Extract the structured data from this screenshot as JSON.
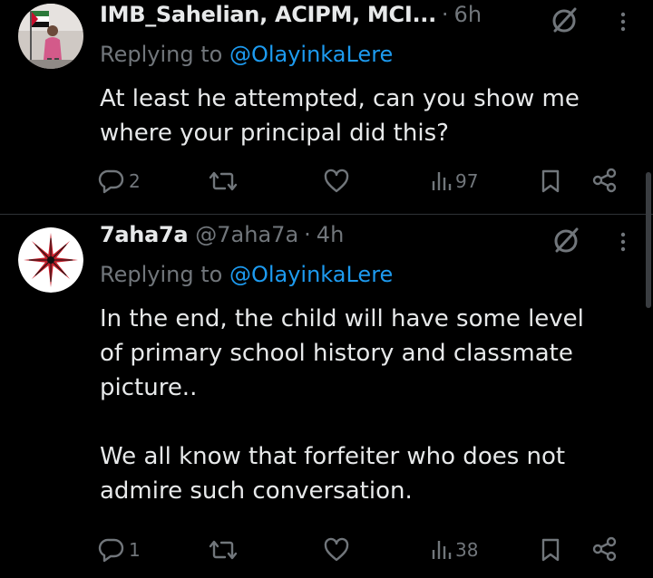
{
  "tweets": [
    {
      "name": "IMB_Sahelian, ACIPM, MCI...",
      "handle": "",
      "time": "6h",
      "replying_prefix": "Replying to",
      "replying_to": "@OlayinkaLere",
      "body": "At least he attempted, can you show me\nwhere your principal did this?",
      "reply_count": "2",
      "retweet_count": "",
      "like_count": "",
      "views": "97",
      "avatar_icon": "user-photo-avatar"
    },
    {
      "name": "7aha7a",
      "handle": "@7aha7a",
      "time": "4h",
      "replying_prefix": "Replying to",
      "replying_to": "@OlayinkaLere",
      "body": "In the end, the child will have some level\nof primary school history and classmate\npicture..\n\nWe all know that forfeiter who does not\nadmire such conversation.",
      "reply_count": "1",
      "retweet_count": "",
      "like_count": "",
      "views": "38",
      "avatar_icon": "compass-star-avatar"
    }
  ],
  "separator": "·",
  "colors": {
    "background": "#000000",
    "text": "#e7e9ea",
    "muted": "#71767b",
    "link": "#1d9bf0",
    "divider": "#2f3336"
  },
  "icons": [
    "grok-icon",
    "more-icon",
    "reply-icon",
    "retweet-icon",
    "like-icon",
    "views-icon",
    "bookmark-icon",
    "share-icon"
  ]
}
